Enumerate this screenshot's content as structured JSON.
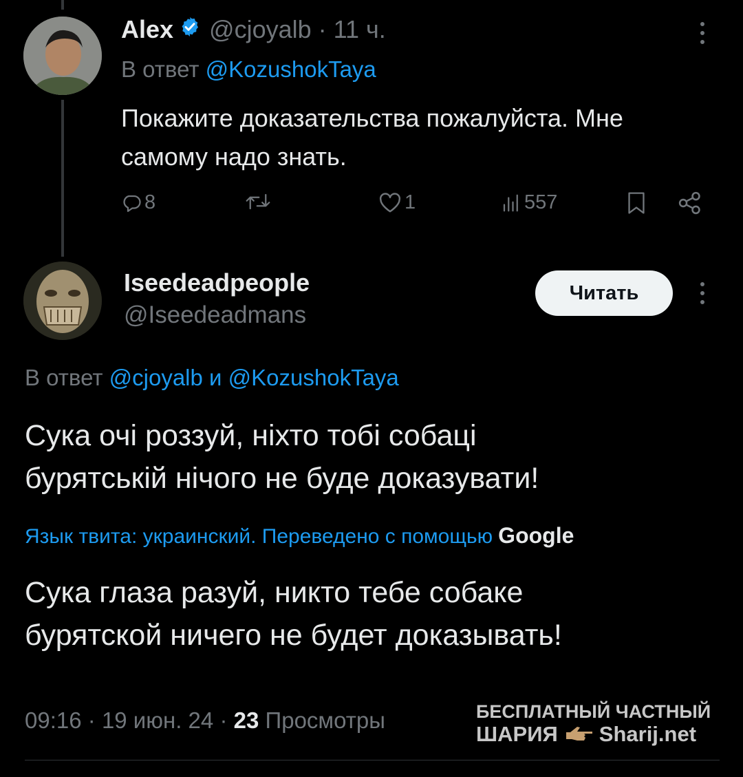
{
  "tweet1": {
    "name": "Alex",
    "handle": "@cjoyalb",
    "time_sep": "·",
    "time": "11 ч.",
    "reply_prefix": "В ответ",
    "reply_to": "@KozushokTaya",
    "text_line1": "Покажите доказательства пожалуйста. Мне",
    "text_line2": "самому надо знать.",
    "replies": "8",
    "likes": "1",
    "views": "557"
  },
  "tweet2": {
    "name": "Iseedeadpeople",
    "handle": "@Iseedeadmans",
    "follow_label": "Читать",
    "reply_prefix": "В ответ",
    "reply_to_1": "@cjoyalb",
    "reply_and": "и",
    "reply_to_2": "@KozushokTaya",
    "text_line1": "Сука очі роззуй, ніхто тобі собаці",
    "text_line2": "бурятській нічого не буде доказувати!",
    "translation_note": "Язык твита: украинский. Переведено с помощью",
    "translation_provider": "Google",
    "translated_line1": "Сука глаза разуй, никто тебе собаке",
    "translated_line2": "бурятской ничего не будет доказывать!",
    "time": "09:16",
    "sep1": "·",
    "date": "19 июн. 24",
    "sep2": "·",
    "views_count": "23",
    "views_label": "Просмотры"
  },
  "watermark": {
    "line1": "БЕСПЛАТНЫЙ ЧАСТНЫЙ",
    "line2_left": "ШАРИЯ",
    "line2_right": "Sharij.net"
  },
  "colors": {
    "background": "#000000",
    "text": "#e7e9ea",
    "muted": "#71767b",
    "link": "#1d9bf0",
    "verified": "#1d9bf0"
  }
}
